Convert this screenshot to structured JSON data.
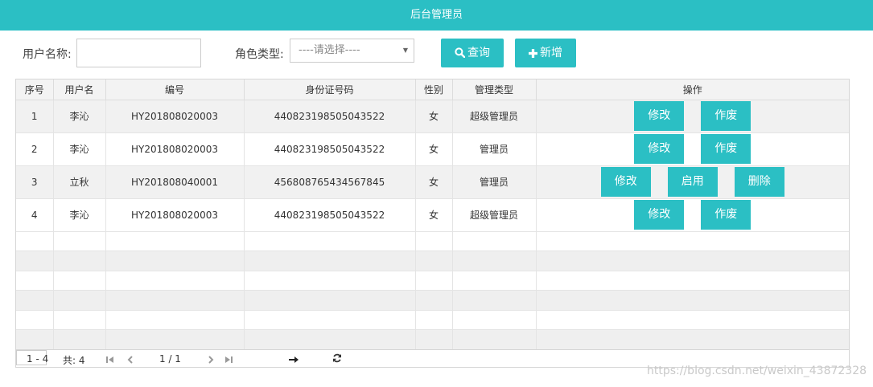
{
  "header": {
    "title": "后台管理员"
  },
  "filters": {
    "username_label": "用户名称:",
    "username_value": "",
    "role_label": "角色类型:",
    "role_selected": "----请选择----",
    "query_label": "查询",
    "add_label": "新增"
  },
  "table": {
    "columns": [
      "序号",
      "用户名",
      "编号",
      "身份证号码",
      "性别",
      "管理类型",
      "操作"
    ],
    "rows": [
      {
        "seq": "1",
        "username": "李沁",
        "code": "HY201808020003",
        "id_number": "440823198505043522",
        "gender": "女",
        "admin_type": "超级管理员",
        "actions": [
          "修改",
          "作废"
        ]
      },
      {
        "seq": "2",
        "username": "李沁",
        "code": "HY201808020003",
        "id_number": "440823198505043522",
        "gender": "女",
        "admin_type": "管理员",
        "actions": [
          "修改",
          "作废"
        ]
      },
      {
        "seq": "3",
        "username": "立秋",
        "code": "HY201808040001",
        "id_number": "456808765434567845",
        "gender": "女",
        "admin_type": "管理员",
        "actions": [
          "修改",
          "启用",
          "删除"
        ]
      },
      {
        "seq": "4",
        "username": "李沁",
        "code": "HY201808020003",
        "id_number": "440823198505043522",
        "gender": "女",
        "admin_type": "超级管理员",
        "actions": [
          "修改",
          "作废"
        ]
      }
    ]
  },
  "pager": {
    "range": "1 - 4",
    "total": "共: 4",
    "page": "1 / 1",
    "page_input": ""
  },
  "watermark": "https://blog.csdn.net/weixin_43872328",
  "colors": {
    "accent": "#2bbfc4"
  }
}
